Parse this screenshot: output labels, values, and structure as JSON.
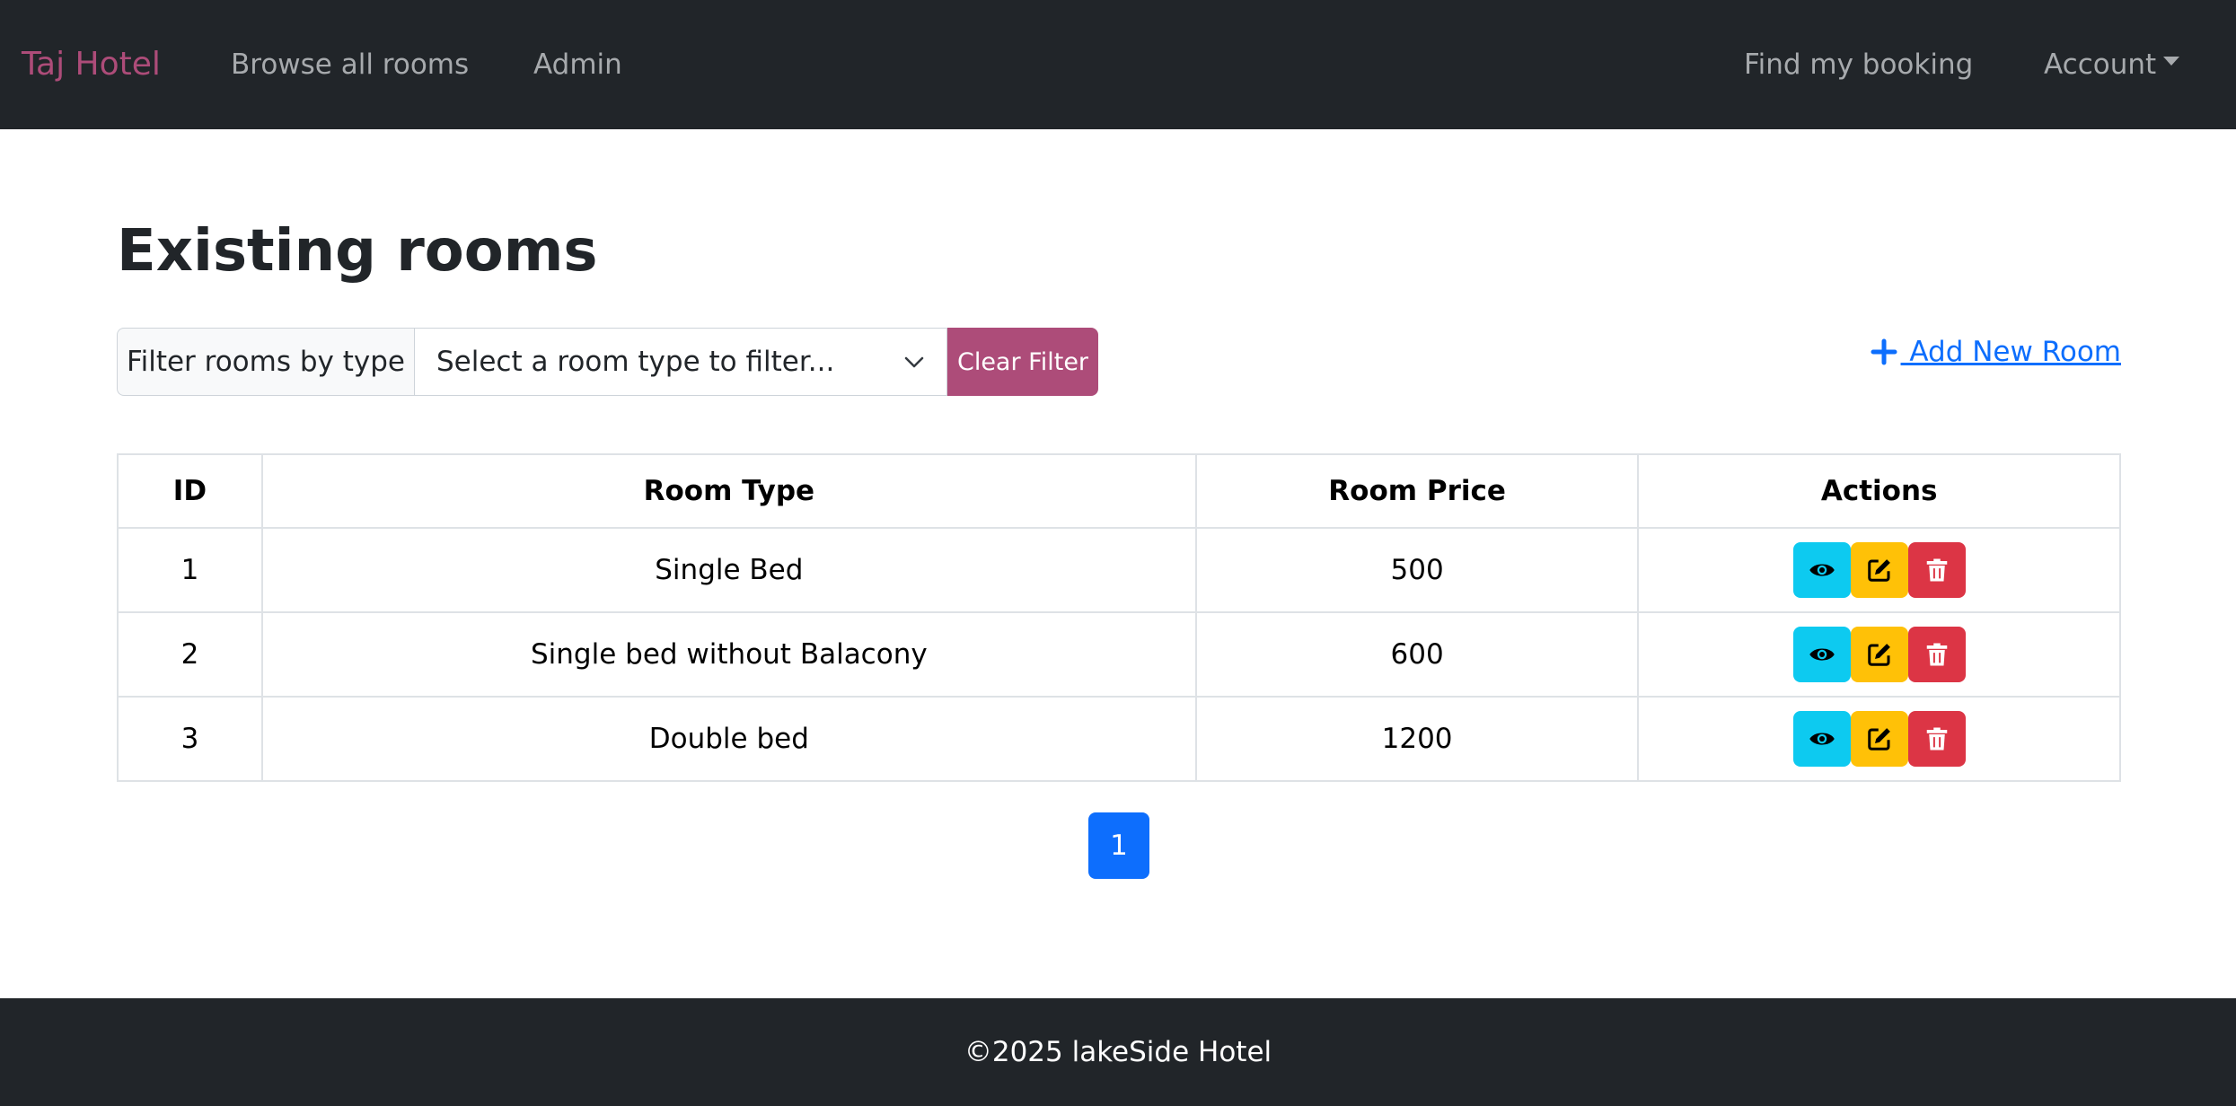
{
  "navbar": {
    "brand": "Taj Hotel",
    "links": [
      "Browse all rooms",
      "Admin"
    ],
    "right_links": [
      "Find my booking",
      "Account"
    ]
  },
  "page": {
    "title": "Existing rooms"
  },
  "filter": {
    "label": "Filter rooms by type",
    "selected": "Select a room type to filter...",
    "clear_label": "Clear Filter"
  },
  "add_room_label": " Add New Room",
  "table": {
    "headers": [
      "ID",
      "Room Type",
      "Room Price",
      "Actions"
    ],
    "rows": [
      {
        "id": "1",
        "type": "Single Bed",
        "price": "500"
      },
      {
        "id": "2",
        "type": "Single bed without Balacony",
        "price": "600"
      },
      {
        "id": "3",
        "type": "Double bed",
        "price": "1200"
      }
    ]
  },
  "pagination": {
    "current": "1"
  },
  "footer": {
    "text": "©2025 lakeSide Hotel"
  },
  "colors": {
    "navbar_bg": "#212529",
    "brand": "#ad4c79",
    "accent_button": "#ad4c79",
    "link": "#0d6efd",
    "view_button": "#0dcaf0",
    "edit_button": "#ffc107",
    "delete_button": "#dc3545"
  },
  "icons": {
    "view": "eye-icon",
    "edit": "edit-icon",
    "delete": "trash-icon",
    "add": "plus-icon",
    "select": "chevron-down-icon",
    "account": "caret-down-icon"
  }
}
